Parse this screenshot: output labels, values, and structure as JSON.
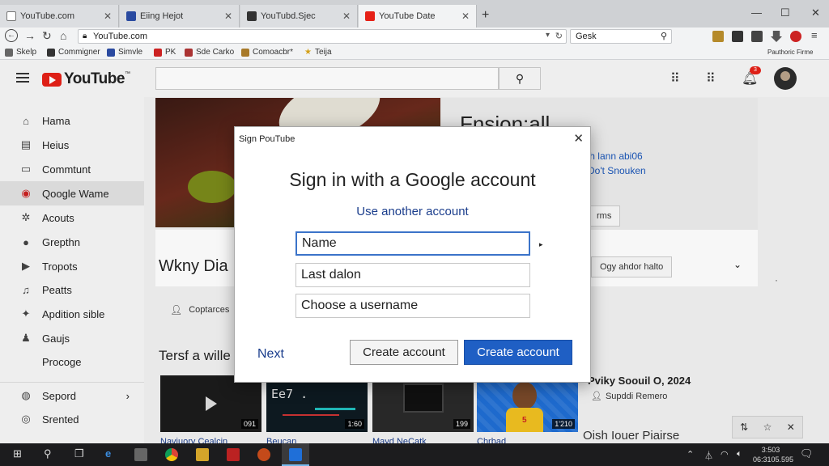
{
  "browser": {
    "tabs": [
      {
        "label": "YouTube.com",
        "active": false
      },
      {
        "label": "Eiing Hejot",
        "active": false
      },
      {
        "label": "YouTubd.Sjec",
        "active": false
      },
      {
        "label": "YouTube Date",
        "active": true
      }
    ],
    "address": "YouTube.com",
    "search_value": "Gesk",
    "bookmarks": [
      "Skelp",
      "Commigner",
      "Simvle",
      "PK",
      "Sde Carko",
      "Comoacbr*",
      "Teija"
    ],
    "profile_label": "Pauthoric Firme"
  },
  "youtube": {
    "logo_text": "YouTube",
    "logo_sup": "™",
    "notification_count": "3",
    "sidebar": [
      {
        "label": "Hama",
        "icon": "home-icon",
        "glyph": "⌂"
      },
      {
        "label": "Heius",
        "icon": "trending-icon",
        "glyph": "▤"
      },
      {
        "label": "Commtunt",
        "icon": "subscriptions-icon",
        "glyph": "▭"
      },
      {
        "label": "Qoogle Wame",
        "icon": "google-icon",
        "glyph": "◉"
      },
      {
        "label": "Acouts",
        "icon": "gear-icon",
        "glyph": "✲"
      },
      {
        "label": "Grepthn",
        "icon": "person-icon",
        "glyph": "●"
      },
      {
        "label": "Tropots",
        "icon": "play-box-icon",
        "glyph": "▶"
      },
      {
        "label": "Peatts",
        "icon": "music-icon",
        "glyph": "♫"
      },
      {
        "label": "Apdition sible",
        "icon": "lightbulb-icon",
        "glyph": "✦"
      },
      {
        "label": "Gaujs",
        "icon": "games-icon",
        "glyph": "♟"
      },
      {
        "label": "Procoge",
        "icon": "none",
        "glyph": ""
      },
      {
        "label": "Sepord",
        "icon": "globe-icon",
        "glyph": "◍"
      },
      {
        "label": "Srented",
        "icon": "circle-icon",
        "glyph": "◎"
      }
    ],
    "right_panel": {
      "title": "Fnsion:all",
      "link1": "'h lann abi06",
      "link2": "Do't Snouken",
      "button": "rms"
    },
    "channel": {
      "title": "Wkny Dia",
      "sub": "Coptarces",
      "button": "Ogy ahdor halto"
    },
    "section_title": "Tersf a wille",
    "videos": [
      {
        "duration": "091",
        "title": "Naviuorv Cealcin"
      },
      {
        "duration": "1:60",
        "title": "Beucan",
        "code": "Ee7 ."
      },
      {
        "duration": "199",
        "title": "Mayd NeCatk"
      },
      {
        "duration": "1'210",
        "title": "Chrbad",
        "badge": "5"
      }
    ],
    "side_video": {
      "title": "Pviky Soouil O, 2024",
      "sub": "Supddi Remero",
      "bottom": "Oish Iouer Piairse"
    }
  },
  "dialog": {
    "title": "Sign PouTube",
    "heading": "Sign in with a Google account",
    "subheading": "Use another account",
    "fields": {
      "name": "Name",
      "last_name": "Last dalon",
      "username": "Choose a username"
    },
    "next": "Next",
    "secondary_button": "Create account",
    "primary_button": "Create account"
  },
  "taskbar": {
    "clock_time": "3:503",
    "clock_date": "06:3105.595"
  }
}
